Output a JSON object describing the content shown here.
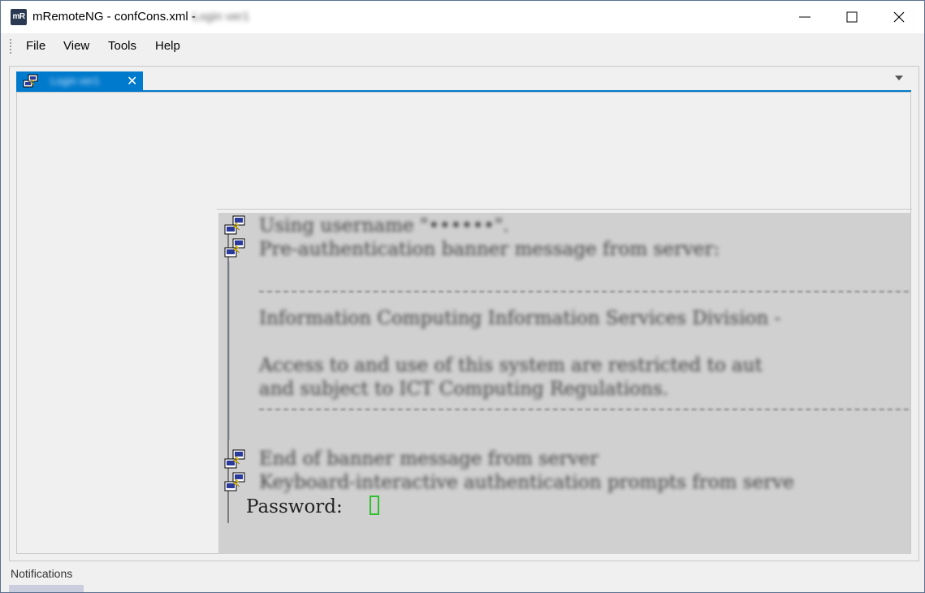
{
  "window": {
    "app_logo": "mR",
    "title": "mRemoteNG - confCons.xml -",
    "title_suffix": "Login ver1",
    "minimize_icon": "minimize-icon",
    "maximize_icon": "maximize-icon",
    "close_icon": "close-icon"
  },
  "menu": {
    "items": [
      {
        "label": "File"
      },
      {
        "label": "View"
      },
      {
        "label": "Tools"
      },
      {
        "label": "Help"
      }
    ]
  },
  "tabs": {
    "active": {
      "label": "Login ver1",
      "icon": "putty-icon",
      "close": "✕"
    },
    "dropdown_icon": "chevron-down-icon",
    "accent_color": "#007acc"
  },
  "terminal": {
    "lines": [
      "Using username \"••••••\".",
      "Pre-authentication banner message from server:",
      "Information Computing  Information Services Division -",
      "Access to and use of this system are restricted to aut",
      "and subject to ICT Computing Regulations.",
      "End of banner message from server",
      "Keyboard-interactive authentication prompts from serve"
    ],
    "password_prompt": "Password:",
    "cursor_color": "#2fbf2f"
  },
  "notifications": {
    "label": "Notifications"
  }
}
